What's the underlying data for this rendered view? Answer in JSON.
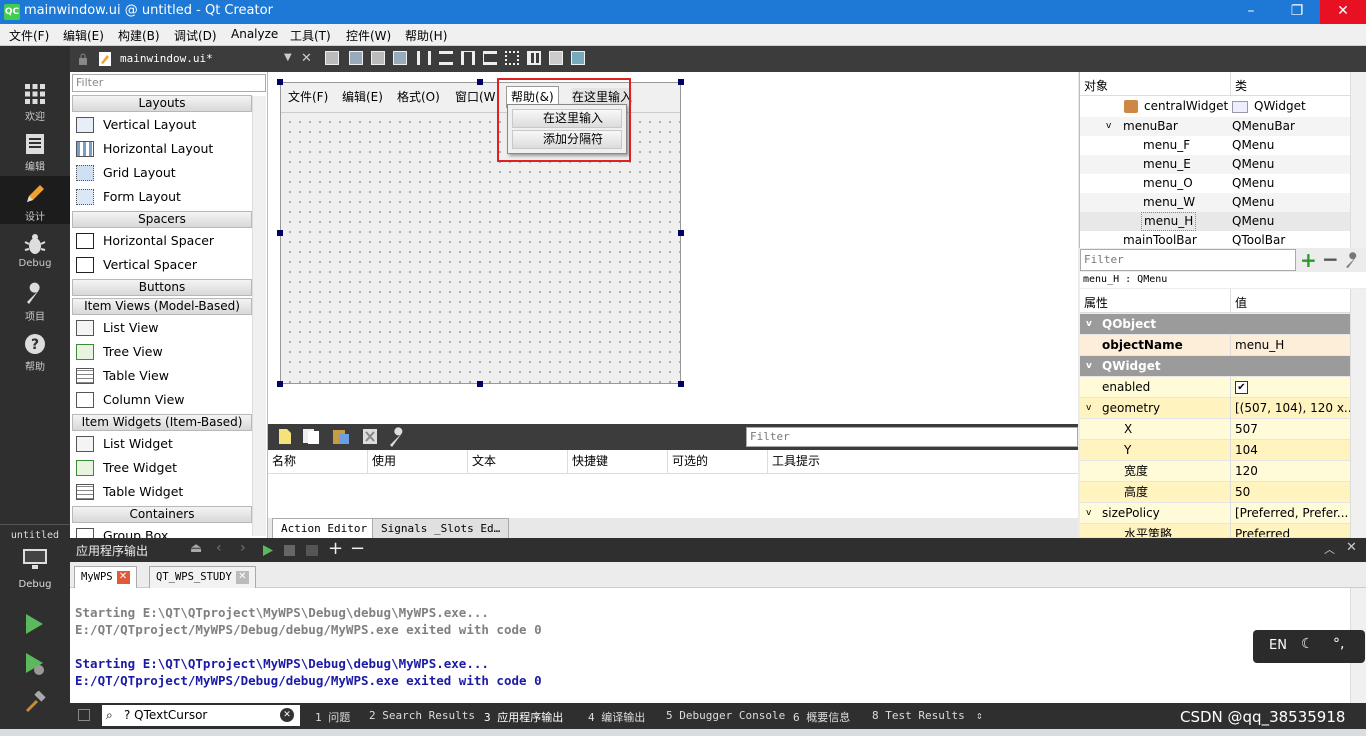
{
  "window": {
    "title": "mainwindow.ui @ untitled - Qt Creator",
    "logo": "QC",
    "min": "–",
    "max": "❐",
    "close": "✕"
  },
  "menubar": [
    "文件(F)",
    "编辑(E)",
    "构建(B)",
    "调试(D)",
    "Analyze",
    "工具(T)",
    "控件(W)",
    "帮助(H)"
  ],
  "modes": [
    {
      "label": "欢迎",
      "icon": "grid-icon"
    },
    {
      "label": "编辑",
      "icon": "document-icon"
    },
    {
      "label": "设计",
      "icon": "pencil-icon"
    },
    {
      "label": "Debug",
      "icon": "bug-icon"
    },
    {
      "label": "项目",
      "icon": "wrench-icon"
    },
    {
      "label": "帮助",
      "icon": "help-icon"
    }
  ],
  "kit": {
    "project": "untitled",
    "build": "Debug"
  },
  "topstrip": {
    "file": "mainwindow.ui*",
    "close": "✕"
  },
  "widgetbox": {
    "filter": "Filter",
    "cats": [
      "Layouts",
      "Spacers",
      "Buttons",
      "Item Views (Model-Based)",
      "Item Widgets (Item-Based)",
      "Containers"
    ],
    "layouts": [
      "Vertical Layout",
      "Horizontal Layout",
      "Grid Layout",
      "Form Layout"
    ],
    "spacers": [
      "Horizontal Spacer",
      "Vertical Spacer"
    ],
    "views": [
      "List View",
      "Tree View",
      "Table View",
      "Column View"
    ],
    "widgets": [
      "List Widget",
      "Tree Widget",
      "Table Widget"
    ],
    "containers": [
      "Group Box"
    ]
  },
  "form": {
    "menus": [
      "文件(F)",
      "编辑(E)",
      "格式(O)",
      "窗口(W",
      "帮助(&)",
      "在这里输入"
    ],
    "popup": [
      "在这里输入",
      "添加分隔符"
    ]
  },
  "action_editor": {
    "filter": "Filter",
    "columns": [
      "名称",
      "使用",
      "文本",
      "快捷键",
      "可选的",
      "工具提示"
    ],
    "tabs": [
      "Action Editor",
      "Signals _Slots Ed…"
    ]
  },
  "object_inspector": {
    "headers": [
      "对象",
      "类"
    ],
    "rows": [
      {
        "name": "centralWidget",
        "cls": "QWidget"
      },
      {
        "name": "menuBar",
        "cls": "QMenuBar"
      },
      {
        "name": "menu_F",
        "cls": "QMenu"
      },
      {
        "name": "menu_E",
        "cls": "QMenu"
      },
      {
        "name": "menu_O",
        "cls": "QMenu"
      },
      {
        "name": "menu_W",
        "cls": "QMenu"
      },
      {
        "name": "menu_H",
        "cls": "QMenu"
      },
      {
        "name": "mainToolBar",
        "cls": "QToolBar"
      }
    ]
  },
  "property_editor": {
    "filter": "Filter",
    "class_line": "menu_H : QMenu",
    "headers": [
      "属性",
      "值"
    ],
    "rows": [
      {
        "name": "QObject",
        "value": ""
      },
      {
        "name": "objectName",
        "value": "menu_H"
      },
      {
        "name": "QWidget",
        "value": ""
      },
      {
        "name": "enabled",
        "value": "✔"
      },
      {
        "name": "geometry",
        "value": "[(507, 104), 120 x..."
      },
      {
        "name": "X",
        "value": "507"
      },
      {
        "name": "Y",
        "value": "104"
      },
      {
        "name": "宽度",
        "value": "120"
      },
      {
        "name": "高度",
        "value": "50"
      },
      {
        "name": "sizePolicy",
        "value": "[Preferred, Prefer..."
      },
      {
        "name": "水平策略",
        "value": "Preferred"
      }
    ]
  },
  "output": {
    "title": "应用程序输出",
    "tabs": [
      "MyWPS",
      "QT_WPS_STUDY"
    ],
    "lines": [
      "Starting E:\\QT\\QTproject\\MyWPS\\Debug\\debug\\MyWPS.exe...",
      "E:/QT/QTproject/MyWPS/Debug/debug/MyWPS.exe exited with code 0",
      "Starting E:\\QT\\QTproject\\MyWPS\\Debug\\debug\\MyWPS.exe...",
      "E:/QT/QTproject/MyWPS/Debug/debug/MyWPS.exe exited with code 0"
    ]
  },
  "statusbar": {
    "locator": "? QTextCursor",
    "panes": [
      "1 问题",
      "2 Search Results",
      "3 应用程序输出",
      "4 编译输出",
      "5 Debugger Console",
      "6 概要信息",
      "8 Test Results"
    ]
  },
  "ime": {
    "lang": "EN"
  },
  "watermark": "CSDN @qq_38535918",
  "colors": {
    "titlebar": "#1d78d6",
    "highlight": "#e02020",
    "output_blue": "#1a1aa6",
    "output_gray": "#808080"
  }
}
